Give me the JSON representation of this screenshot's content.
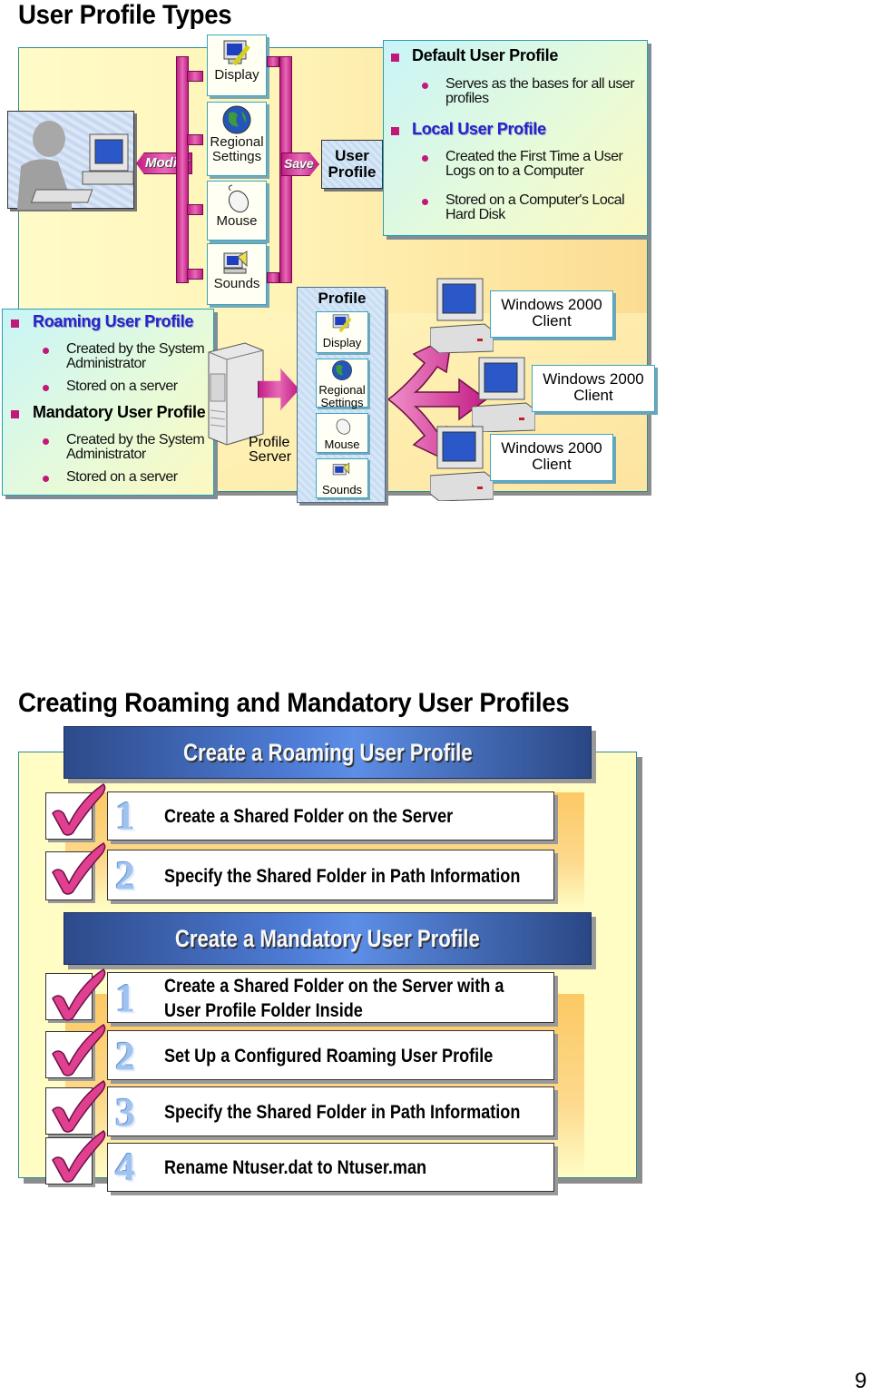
{
  "slide1": {
    "title": "User Profile Types",
    "flow": {
      "modify_label": "Modify",
      "save_label": "Save",
      "settings_tiles": [
        {
          "label": "Display",
          "icon": "display-icon"
        },
        {
          "label": "Regional Settings",
          "icon": "globe-icon"
        },
        {
          "label": "Mouse",
          "icon": "mouse-icon"
        },
        {
          "label": "Sounds",
          "icon": "sounds-icon"
        }
      ],
      "user_profile_label": "User Profile"
    },
    "top_info": {
      "items": [
        {
          "heading": "Default User Profile",
          "style": "black",
          "bullets": [
            "Serves as the bases for all user profiles"
          ]
        },
        {
          "heading": "Local User Profile",
          "style": "blue",
          "bullets": [
            "Created the First Time a User Logs on to a Computer",
            "Stored on a Computer's Local Hard Disk"
          ]
        }
      ]
    },
    "left_info": {
      "items": [
        {
          "heading": "Roaming User Profile",
          "style": "blue",
          "bullets": [
            "Created by the System Administrator",
            "Stored on a server"
          ]
        },
        {
          "heading": "Mandatory User Profile",
          "style": "black",
          "bullets": [
            "Created by the System Administrator",
            "Stored on a server"
          ]
        }
      ]
    },
    "server_label": "Profile Server",
    "profile_column": {
      "title": "Profile",
      "items": [
        "Display",
        "Regional Settings",
        "Mouse",
        "Sounds"
      ]
    },
    "clients": [
      "Windows 2000 Client",
      "Windows 2000 Client",
      "Windows 2000 Client"
    ]
  },
  "slide2": {
    "title": "Creating Roaming and Mandatory User Profiles",
    "sections": [
      {
        "banner": "Create a Roaming User Profile",
        "steps": [
          {
            "number": "1",
            "text": "Create a Shared Folder on the Server",
            "checked": true
          },
          {
            "number": "2",
            "text": "Specify the Shared Folder in Path Information",
            "checked": true
          }
        ]
      },
      {
        "banner": "Create a Mandatory User Profile",
        "steps": [
          {
            "number": "1",
            "text": "Create a Shared Folder on the Server with a",
            "text2": "User Profile Folder Inside",
            "checked": true
          },
          {
            "number": "2",
            "text": "Set Up a Configured Roaming User Profile",
            "checked": true
          },
          {
            "number": "3",
            "text": "Specify the Shared Folder in Path Information",
            "checked": true
          },
          {
            "number": "4",
            "text": "Rename Ntuser.dat to Ntuser.man",
            "checked": true
          }
        ]
      }
    ]
  },
  "page_number": "9",
  "colors": {
    "accent_pink": "#c2187a",
    "heading_blue": "#2424c8",
    "banner_blue": "#3b62b8",
    "panel_yellow": "#fffcc4"
  }
}
